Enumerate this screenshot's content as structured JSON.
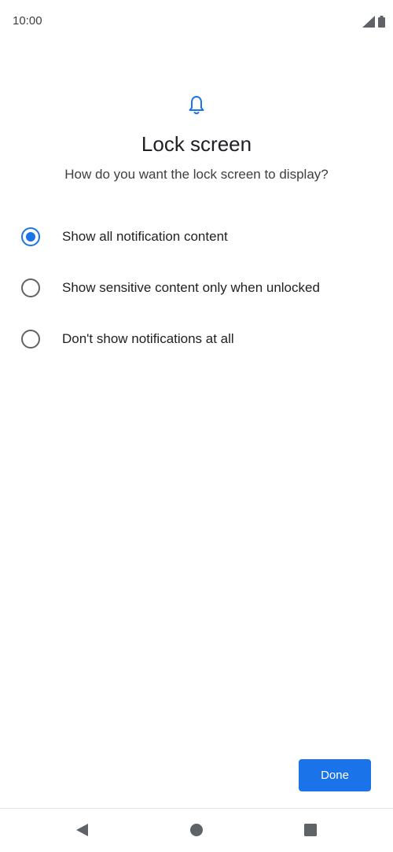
{
  "status_bar": {
    "time": "10:00",
    "icons": [
      "signal-icon",
      "battery-icon"
    ]
  },
  "header": {
    "icon": "bell-icon",
    "title": "Lock screen",
    "subtitle": "How do you want the lock screen to display?"
  },
  "options": [
    {
      "label": "Show all notification content",
      "selected": true
    },
    {
      "label": "Show sensitive content only when unlocked",
      "selected": false
    },
    {
      "label": "Don't show notifications at all",
      "selected": false
    }
  ],
  "footer": {
    "done_label": "Done"
  },
  "nav_bar": {
    "icons": [
      "back-icon",
      "home-icon",
      "recents-icon"
    ]
  },
  "colors": {
    "accent": "#1a73e8",
    "radio_unchecked": "#5f6368",
    "text_primary": "#202124"
  }
}
